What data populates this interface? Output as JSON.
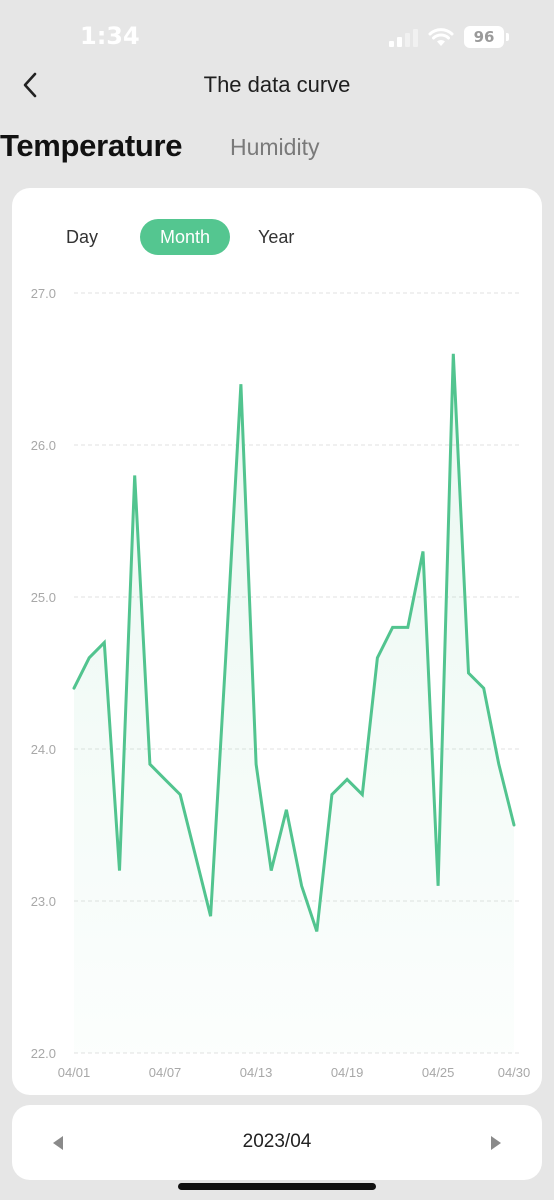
{
  "status": {
    "time": "1:34",
    "battery": "96"
  },
  "nav": {
    "title": "The data curve",
    "back_icon": "chevron-left-icon"
  },
  "tabs": [
    {
      "label": "Temperature",
      "active": true
    },
    {
      "label": "Humidity",
      "active": false
    }
  ],
  "period": {
    "options": [
      "Day",
      "Month",
      "Year"
    ],
    "selected": "Month"
  },
  "footer": {
    "date": "2023/04",
    "prev_icon": "triangle-left-icon",
    "next_icon": "triangle-right-icon"
  },
  "colors": {
    "accent": "#54c690",
    "line": "#52c48f",
    "background": "#e6e6e6",
    "card": "#ffffff"
  },
  "chart_data": {
    "type": "area",
    "x": [
      "04/01",
      "04/02",
      "04/03",
      "04/04",
      "04/05",
      "04/06",
      "04/07",
      "04/08",
      "04/09",
      "04/10",
      "04/11",
      "04/12",
      "04/13",
      "04/14",
      "04/15",
      "04/16",
      "04/17",
      "04/18",
      "04/19",
      "04/20",
      "04/21",
      "04/22",
      "04/23",
      "04/24",
      "04/25",
      "04/26",
      "04/27",
      "04/28",
      "04/29",
      "04/30"
    ],
    "series": [
      {
        "values": [
          24.4,
          24.6,
          24.7,
          23.2,
          25.8,
          23.9,
          23.8,
          23.7,
          23.3,
          22.9,
          24.6,
          26.4,
          23.9,
          23.2,
          23.6,
          23.1,
          22.8,
          23.7,
          23.8,
          23.7,
          24.6,
          24.8,
          24.8,
          25.3,
          23.1,
          26.6,
          24.5,
          24.4,
          23.9,
          23.5
        ]
      }
    ],
    "x_tick_labels": [
      "04/01",
      "04/07",
      "04/13",
      "04/19",
      "04/25",
      "04/30"
    ],
    "y_tick_labels": [
      "22.0",
      "23.0",
      "24.0",
      "25.0",
      "26.0",
      "27.0"
    ],
    "ylim": [
      22.0,
      27.0
    ],
    "grid": true,
    "legend": "none"
  }
}
